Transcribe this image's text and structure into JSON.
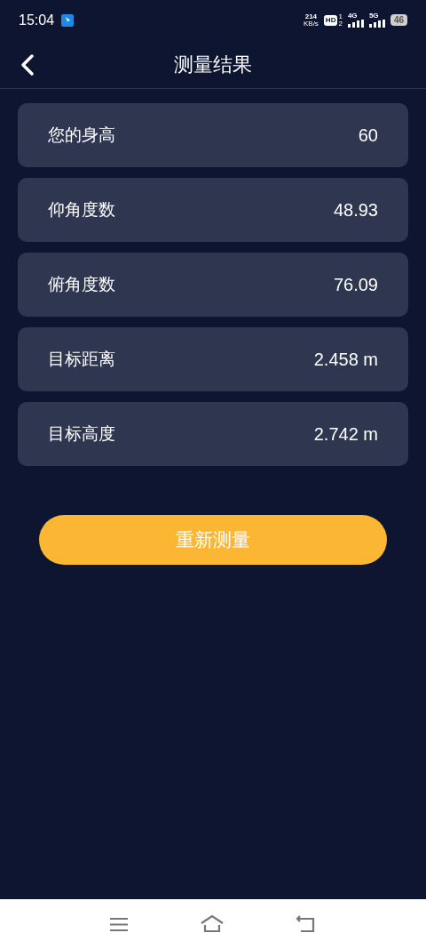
{
  "status_bar": {
    "time": "15:04",
    "speed": "214",
    "speed_unit": "KB/s",
    "hd": "HD",
    "hd_sims": [
      "1",
      "2"
    ],
    "net_4g": "4G",
    "net_5g": "5G",
    "battery": "46"
  },
  "header": {
    "title": "测量结果"
  },
  "results": [
    {
      "label": "您的身高",
      "value": "60"
    },
    {
      "label": "仰角度数",
      "value": "48.93"
    },
    {
      "label": "俯角度数",
      "value": "76.09"
    },
    {
      "label": "目标距离",
      "value": "2.458 m"
    },
    {
      "label": "目标高度",
      "value": "2.742 m"
    }
  ],
  "remeasure_button": "重新测量"
}
